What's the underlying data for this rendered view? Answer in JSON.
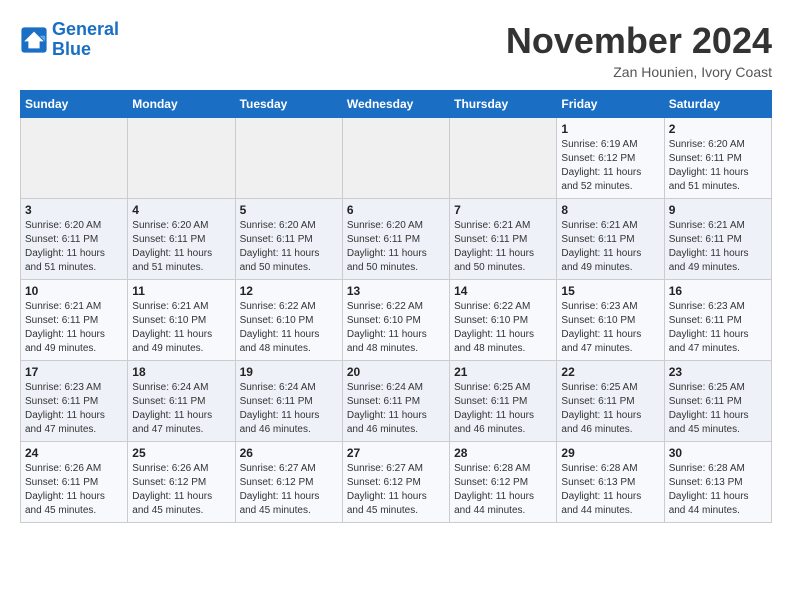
{
  "header": {
    "logo_line1": "General",
    "logo_line2": "Blue",
    "month_title": "November 2024",
    "location": "Zan Hounien, Ivory Coast"
  },
  "weekdays": [
    "Sunday",
    "Monday",
    "Tuesday",
    "Wednesday",
    "Thursday",
    "Friday",
    "Saturday"
  ],
  "weeks": [
    [
      {
        "day": "",
        "info": ""
      },
      {
        "day": "",
        "info": ""
      },
      {
        "day": "",
        "info": ""
      },
      {
        "day": "",
        "info": ""
      },
      {
        "day": "",
        "info": ""
      },
      {
        "day": "1",
        "info": "Sunrise: 6:19 AM\nSunset: 6:12 PM\nDaylight: 11 hours\nand 52 minutes."
      },
      {
        "day": "2",
        "info": "Sunrise: 6:20 AM\nSunset: 6:11 PM\nDaylight: 11 hours\nand 51 minutes."
      }
    ],
    [
      {
        "day": "3",
        "info": "Sunrise: 6:20 AM\nSunset: 6:11 PM\nDaylight: 11 hours\nand 51 minutes."
      },
      {
        "day": "4",
        "info": "Sunrise: 6:20 AM\nSunset: 6:11 PM\nDaylight: 11 hours\nand 51 minutes."
      },
      {
        "day": "5",
        "info": "Sunrise: 6:20 AM\nSunset: 6:11 PM\nDaylight: 11 hours\nand 50 minutes."
      },
      {
        "day": "6",
        "info": "Sunrise: 6:20 AM\nSunset: 6:11 PM\nDaylight: 11 hours\nand 50 minutes."
      },
      {
        "day": "7",
        "info": "Sunrise: 6:21 AM\nSunset: 6:11 PM\nDaylight: 11 hours\nand 50 minutes."
      },
      {
        "day": "8",
        "info": "Sunrise: 6:21 AM\nSunset: 6:11 PM\nDaylight: 11 hours\nand 49 minutes."
      },
      {
        "day": "9",
        "info": "Sunrise: 6:21 AM\nSunset: 6:11 PM\nDaylight: 11 hours\nand 49 minutes."
      }
    ],
    [
      {
        "day": "10",
        "info": "Sunrise: 6:21 AM\nSunset: 6:11 PM\nDaylight: 11 hours\nand 49 minutes."
      },
      {
        "day": "11",
        "info": "Sunrise: 6:21 AM\nSunset: 6:10 PM\nDaylight: 11 hours\nand 49 minutes."
      },
      {
        "day": "12",
        "info": "Sunrise: 6:22 AM\nSunset: 6:10 PM\nDaylight: 11 hours\nand 48 minutes."
      },
      {
        "day": "13",
        "info": "Sunrise: 6:22 AM\nSunset: 6:10 PM\nDaylight: 11 hours\nand 48 minutes."
      },
      {
        "day": "14",
        "info": "Sunrise: 6:22 AM\nSunset: 6:10 PM\nDaylight: 11 hours\nand 48 minutes."
      },
      {
        "day": "15",
        "info": "Sunrise: 6:23 AM\nSunset: 6:10 PM\nDaylight: 11 hours\nand 47 minutes."
      },
      {
        "day": "16",
        "info": "Sunrise: 6:23 AM\nSunset: 6:11 PM\nDaylight: 11 hours\nand 47 minutes."
      }
    ],
    [
      {
        "day": "17",
        "info": "Sunrise: 6:23 AM\nSunset: 6:11 PM\nDaylight: 11 hours\nand 47 minutes."
      },
      {
        "day": "18",
        "info": "Sunrise: 6:24 AM\nSunset: 6:11 PM\nDaylight: 11 hours\nand 47 minutes."
      },
      {
        "day": "19",
        "info": "Sunrise: 6:24 AM\nSunset: 6:11 PM\nDaylight: 11 hours\nand 46 minutes."
      },
      {
        "day": "20",
        "info": "Sunrise: 6:24 AM\nSunset: 6:11 PM\nDaylight: 11 hours\nand 46 minutes."
      },
      {
        "day": "21",
        "info": "Sunrise: 6:25 AM\nSunset: 6:11 PM\nDaylight: 11 hours\nand 46 minutes."
      },
      {
        "day": "22",
        "info": "Sunrise: 6:25 AM\nSunset: 6:11 PM\nDaylight: 11 hours\nand 46 minutes."
      },
      {
        "day": "23",
        "info": "Sunrise: 6:25 AM\nSunset: 6:11 PM\nDaylight: 11 hours\nand 45 minutes."
      }
    ],
    [
      {
        "day": "24",
        "info": "Sunrise: 6:26 AM\nSunset: 6:11 PM\nDaylight: 11 hours\nand 45 minutes."
      },
      {
        "day": "25",
        "info": "Sunrise: 6:26 AM\nSunset: 6:12 PM\nDaylight: 11 hours\nand 45 minutes."
      },
      {
        "day": "26",
        "info": "Sunrise: 6:27 AM\nSunset: 6:12 PM\nDaylight: 11 hours\nand 45 minutes."
      },
      {
        "day": "27",
        "info": "Sunrise: 6:27 AM\nSunset: 6:12 PM\nDaylight: 11 hours\nand 45 minutes."
      },
      {
        "day": "28",
        "info": "Sunrise: 6:28 AM\nSunset: 6:12 PM\nDaylight: 11 hours\nand 44 minutes."
      },
      {
        "day": "29",
        "info": "Sunrise: 6:28 AM\nSunset: 6:13 PM\nDaylight: 11 hours\nand 44 minutes."
      },
      {
        "day": "30",
        "info": "Sunrise: 6:28 AM\nSunset: 6:13 PM\nDaylight: 11 hours\nand 44 minutes."
      }
    ]
  ]
}
